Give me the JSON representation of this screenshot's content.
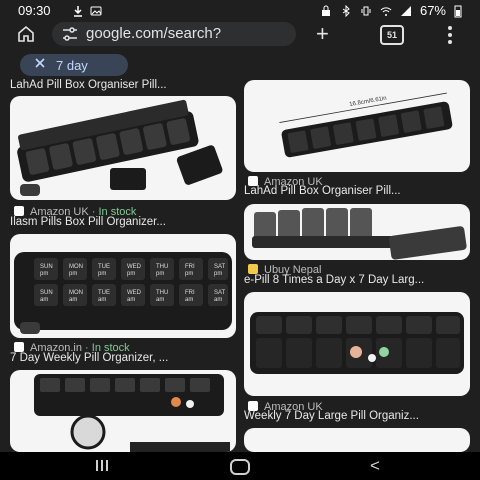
{
  "status_bar": {
    "time": "09:30",
    "battery": "67%"
  },
  "browser": {
    "url": "google.com/search?",
    "tab_count": "51"
  },
  "filter_chip": {
    "label": "7 day"
  },
  "results": [
    {
      "title": "LahAd Pill Box Organiser Pill..."
    },
    {
      "source": "Amazon UK",
      "stock": "· In stock",
      "title": "Ilasm Pills Box Pill Organizer..."
    },
    {
      "source": "Amazon UK",
      "title": "LahAd Pill Box Organiser Pill..."
    },
    {
      "source": "Ubuy Nepal",
      "title": "e-Pill 8 Times a Day x 7 Day Larg..."
    },
    {
      "source": "Amazon.in",
      "stock": "· In stock",
      "title": "7 Day Weekly Pill Organizer, ..."
    },
    {
      "source": "Amazon UK",
      "title": "Weekly 7 Day Large Pill Organiz..."
    }
  ],
  "image_text": {
    "dims_width": "16.8cm/6.61in",
    "day_labels": [
      "SUN",
      "MON",
      "TUE",
      "WED",
      "THU",
      "FRI",
      "SAT"
    ],
    "period_am": "am",
    "period_pm": "pm"
  },
  "icons": {
    "status_left": [
      "download-icon",
      "image-icon"
    ],
    "status_right": [
      "lock-icon",
      "bluetooth-icon",
      "vibrate-icon",
      "wifi-icon",
      "signal-icon",
      "battery-icon"
    ]
  }
}
